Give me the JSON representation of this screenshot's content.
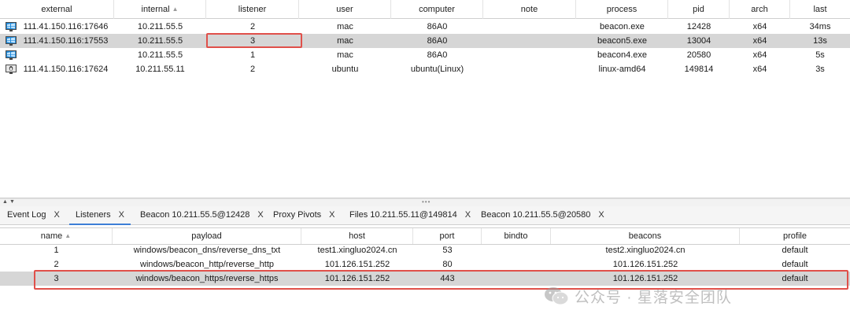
{
  "beacon_table": {
    "columns": [
      "external",
      "internal",
      "listener",
      "user",
      "computer",
      "note",
      "process",
      "pid",
      "arch",
      "last"
    ],
    "sort_column": "internal",
    "rows": [
      {
        "os_icon": "windows-monitor-icon",
        "external": "111.41.150.116:17646",
        "internal": "10.211.55.5",
        "listener": "2",
        "user": "mac",
        "computer": "86A0",
        "note": "",
        "process": "beacon.exe",
        "pid": "12428",
        "arch": "x64",
        "last": "34ms",
        "selected": false
      },
      {
        "os_icon": "windows-monitor-icon",
        "external": "111.41.150.116:17553",
        "internal": "10.211.55.5",
        "listener": "3",
        "user": "mac",
        "computer": "86A0",
        "note": "",
        "process": "beacon5.exe",
        "pid": "13004",
        "arch": "x64",
        "last": "13s",
        "selected": true
      },
      {
        "os_icon": "windows-monitor-icon",
        "external": "",
        "internal": "10.211.55.5",
        "listener": "1",
        "user": "mac",
        "computer": "86A0",
        "note": "",
        "process": "beacon4.exe",
        "pid": "20580",
        "arch": "x64",
        "last": "5s",
        "selected": false
      },
      {
        "os_icon": "linux-monitor-icon",
        "external": "111.41.150.116:17624",
        "internal": "10.211.55.11",
        "listener": "2",
        "user": "ubuntu",
        "computer": "ubuntu(Linux)",
        "note": "",
        "process": "linux-amd64",
        "pid": "149814",
        "arch": "x64",
        "last": "3s",
        "selected": false
      }
    ]
  },
  "tabs": [
    {
      "label": "Event Log",
      "close": "X",
      "active": false
    },
    {
      "label": "Listeners",
      "close": "X",
      "active": true
    },
    {
      "label": "Beacon 10.211.55.5@12428",
      "close": "X",
      "active": false
    },
    {
      "label": "Proxy Pivots",
      "close": "X",
      "active": false
    },
    {
      "label": "Files 10.211.55.11@149814",
      "close": "X",
      "active": false
    },
    {
      "label": "Beacon 10.211.55.5@20580",
      "close": "X",
      "active": false
    }
  ],
  "listeners_table": {
    "columns": [
      "name",
      "payload",
      "host",
      "port",
      "bindto",
      "beacons",
      "profile"
    ],
    "sort_column": "name",
    "rows": [
      {
        "name": "1",
        "payload": "windows/beacon_dns/reverse_dns_txt",
        "host": "test1.xingluo2024.cn",
        "port": "53",
        "bindto": "",
        "beacons": "test2.xingluo2024.cn",
        "profile": "default",
        "selected": false
      },
      {
        "name": "2",
        "payload": "windows/beacon_http/reverse_http",
        "host": "101.126.151.252",
        "port": "80",
        "bindto": "",
        "beacons": "101.126.151.252",
        "profile": "default",
        "selected": false
      },
      {
        "name": "3",
        "payload": "windows/beacon_https/reverse_https",
        "host": "101.126.151.252",
        "port": "443",
        "bindto": "",
        "beacons": "101.126.151.252",
        "profile": "default",
        "selected": true
      }
    ]
  },
  "watermark": {
    "text": "公众号 · 星落安全团队"
  },
  "colors": {
    "highlight_red": "#e0504a",
    "selected_row": "#d6d6d6",
    "active_tab": "#3d7fd6",
    "windows_icon": "#1e88d8"
  }
}
